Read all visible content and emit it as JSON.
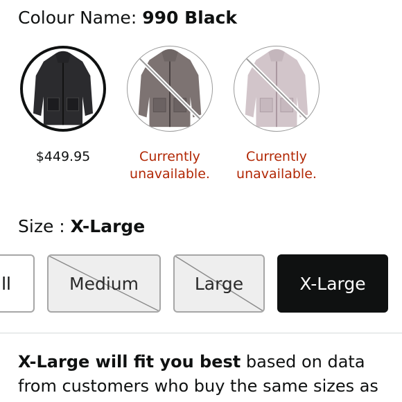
{
  "colour": {
    "label": "Colour Name:",
    "value": "990 Black"
  },
  "swatches": [
    {
      "name": "black",
      "price": "$449.95",
      "selected": true,
      "color": "#2b2b2e"
    },
    {
      "name": "grey",
      "status": [
        "Currently",
        "unavailable."
      ],
      "selected": false,
      "color": "#7d7372"
    },
    {
      "name": "pink",
      "status": [
        "Currently",
        "unavailable."
      ],
      "selected": false,
      "color": "#d2c5ca"
    }
  ],
  "size": {
    "label": "Size :",
    "value": "X-Large"
  },
  "size_options": [
    {
      "label": "Small",
      "visible_text": "ll",
      "state": "available"
    },
    {
      "label": "Medium",
      "state": "unavailable"
    },
    {
      "label": "Large",
      "state": "unavailable"
    },
    {
      "label": "X-Large",
      "state": "selected"
    }
  ],
  "fit": {
    "strong": "X-Large will fit you best",
    "line1_rest": " based on data",
    "line2": "from customers who buy the same sizes as"
  },
  "colors": {
    "unavailable_text": "#b12704",
    "selected_bg": "#0f1111",
    "unavailable_bg": "#eeeeee"
  }
}
